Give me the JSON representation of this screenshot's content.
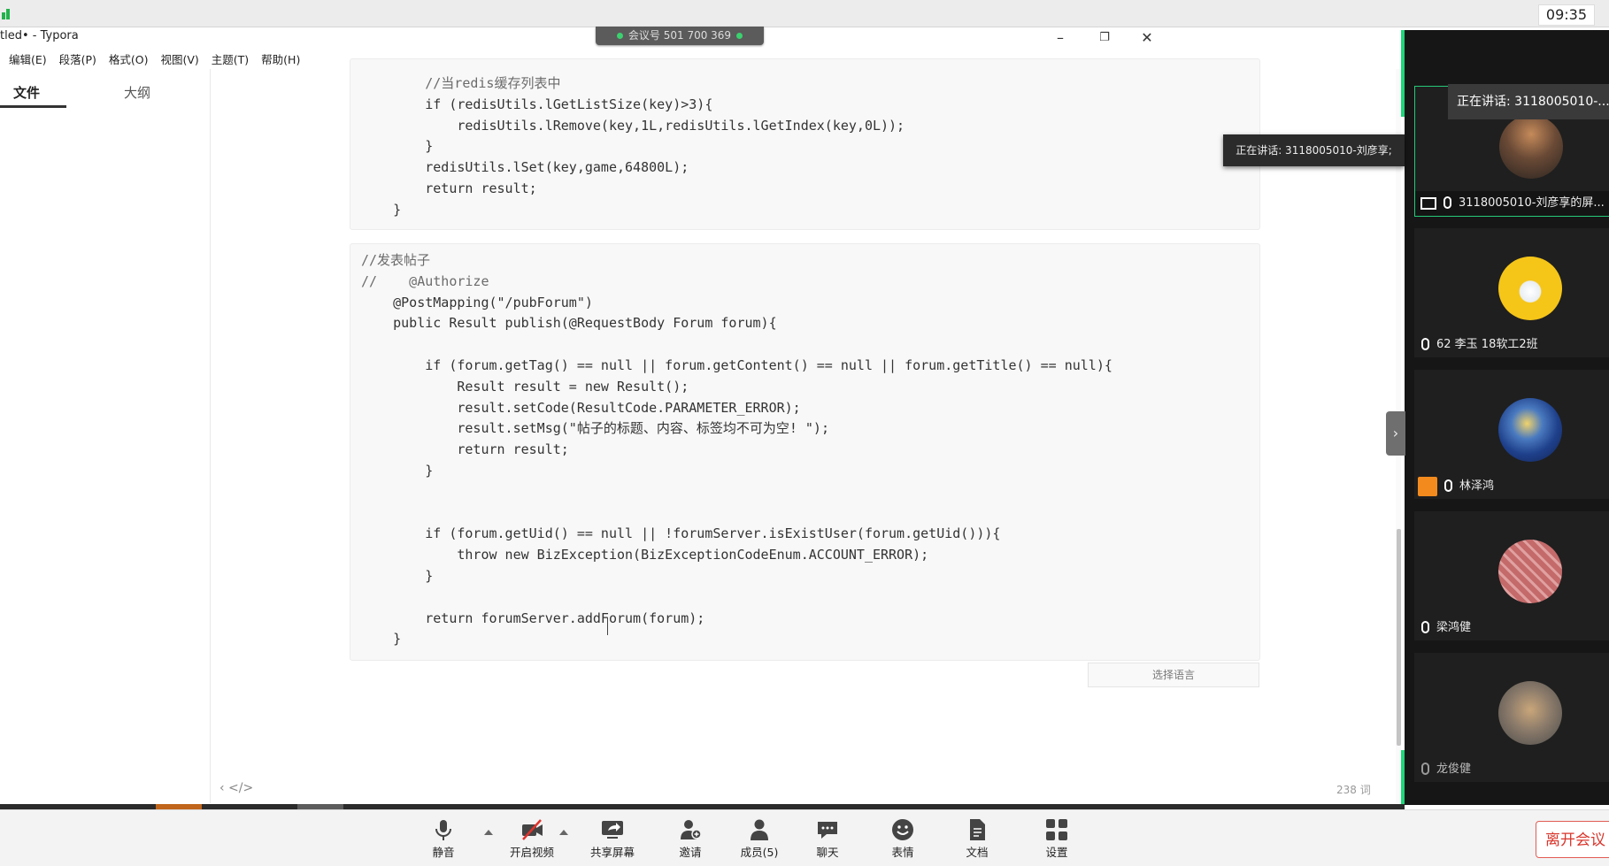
{
  "system": {
    "clock": "09:35"
  },
  "window": {
    "title": "tled• - Typora",
    "meeting_id": "会议号 501 700 369",
    "controls": {
      "minimize": "–",
      "restore": "❐",
      "close": "✕"
    }
  },
  "menu": [
    "编辑(E)",
    "段落(P)",
    "格式(O)",
    "视图(V)",
    "主题(T)",
    "帮助(H)"
  ],
  "sidebar": {
    "tab_file": "文件",
    "tab_outline": "大纲"
  },
  "code_block_1": [
    {
      "t": "        //当redis缓存列表中",
      "c": true
    },
    {
      "t": "        if (redisUtils.lGetListSize(key)>3){"
    },
    {
      "t": "            redisUtils.lRemove(key,1L,redisUtils.lGetIndex(key,0L));"
    },
    {
      "t": "        }"
    },
    {
      "t": "        redisUtils.lSet(key,game,64800L);"
    },
    {
      "t": "        return result;"
    },
    {
      "t": "    }"
    }
  ],
  "code_block_2": [
    {
      "t": "//发表帖子",
      "c": true
    },
    {
      "t": "//    @Authorize",
      "c": true
    },
    {
      "t": "    @PostMapping(\"/pubForum\")"
    },
    {
      "t": "    public Result publish(@RequestBody Forum forum){"
    },
    {
      "t": ""
    },
    {
      "t": "        if (forum.getTag() == null || forum.getContent() == null || forum.getTitle() == null){"
    },
    {
      "t": "            Result result = new Result();"
    },
    {
      "t": "            result.setCode(ResultCode.PARAMETER_ERROR);"
    },
    {
      "t": "            result.setMsg(\"帖子的标题、内容、标签均不可为空! \");"
    },
    {
      "t": "            return result;"
    },
    {
      "t": "        }"
    },
    {
      "t": ""
    },
    {
      "t": ""
    },
    {
      "t": "        if (forum.getUid() == null || !forumServer.isExistUser(forum.getUid())){"
    },
    {
      "t": "            throw new BizException(BizExceptionCodeEnum.ACCOUNT_ERROR);"
    },
    {
      "t": "        }"
    },
    {
      "t": ""
    },
    {
      "t": "        return forumServer.addForum(forum);"
    },
    {
      "t": "    }"
    }
  ],
  "editor": {
    "language_select": "选择语言",
    "status_left": "‹   </>",
    "word_count": "238 词"
  },
  "tooltip": "正在讲话: 3118005010-刘彦享;",
  "participants": {
    "speaking_header": "正在讲话: 3118005010-...",
    "tiles": [
      {
        "name": "3118005010-刘彦享的屏...",
        "avatar_color": "#5a4a3c"
      },
      {
        "name": "62 李玉 18软工2班",
        "avatar_color": "#f5c518"
      },
      {
        "name": "林泽鸿",
        "avatar_color": "#1e3f8a"
      },
      {
        "name": "梁鸿健",
        "avatar_color": "#c46a6a"
      },
      {
        "name": "龙俊健",
        "avatar_color": "#8a7a6a"
      }
    ]
  },
  "toolbar": {
    "mute": "静音",
    "video": "开启视频",
    "share": "共享屏幕",
    "invite": "邀请",
    "members": "成员(5)",
    "chat": "聊天",
    "emoji": "表情",
    "docs": "文档",
    "settings": "设置",
    "leave": "离开会议"
  }
}
